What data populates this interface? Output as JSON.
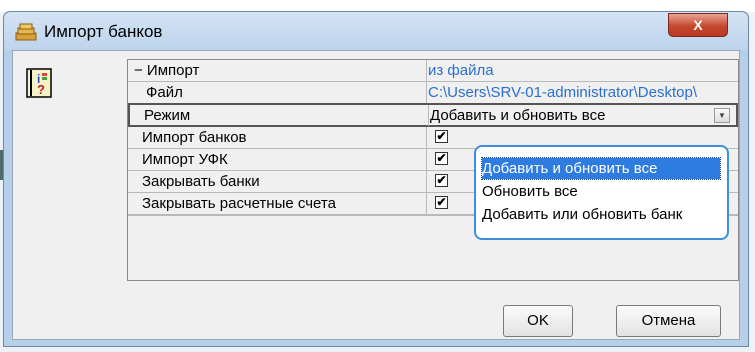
{
  "window": {
    "title": "Импорт банков",
    "close_glyph": "X"
  },
  "grid": {
    "rows": [
      {
        "label": "− Импорт",
        "value": "из файла"
      },
      {
        "label": "Файл",
        "value": "C:\\Users\\SRV-01-administrator\\Desktop\\"
      },
      {
        "label": "Режим",
        "value": "Добавить и обновить все"
      },
      {
        "label": "Импорт банков",
        "checked": "✔"
      },
      {
        "label": "Импорт УФК",
        "checked": "✔"
      },
      {
        "label": "Закрывать банки",
        "checked": "✔"
      },
      {
        "label": "Закрывать расчетные счета",
        "checked": "✔"
      }
    ]
  },
  "dropdown": {
    "options": [
      "Добавить и обновить все",
      "Обновить все",
      "Добавить или обновить банк"
    ],
    "selected_index": 0
  },
  "buttons": {
    "ok": "OK",
    "cancel": "Отмена"
  },
  "icons": {
    "app": "bank-stack-icon",
    "book": "info-book-icon",
    "close": "close-icon",
    "dropdown": "chevron-down-icon"
  }
}
